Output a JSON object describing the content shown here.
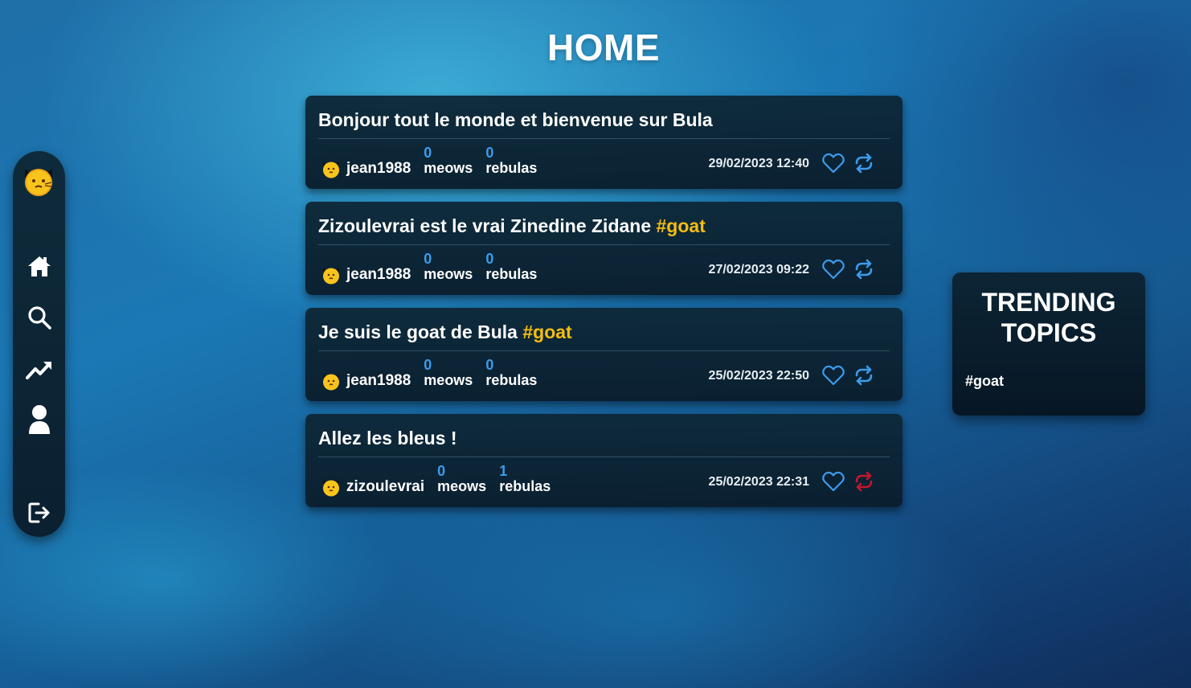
{
  "page": {
    "title": "HOME"
  },
  "sidebar": {
    "logo": "cat-logo-icon",
    "items": [
      {
        "icon": "home-icon",
        "label": "home"
      },
      {
        "icon": "search-icon",
        "label": "search"
      },
      {
        "icon": "trending-icon",
        "label": "trending"
      },
      {
        "icon": "user-icon",
        "label": "profile"
      },
      {
        "icon": "logout-icon",
        "label": "logout"
      }
    ]
  },
  "posts": [
    {
      "text": "Bonjour tout le monde et bienvenue sur Bula",
      "hashtag": "",
      "username": "jean1988",
      "meows": "0",
      "meows_label": "meows",
      "rebulas": "0",
      "rebulas_label": "rebulas",
      "date": "29/02/2023 12:40",
      "rebula_color": "#3d9bea"
    },
    {
      "text": "Zizoulevrai est le vrai Zinedine Zidane ",
      "hashtag": "#goat",
      "username": "jean1988",
      "meows": "0",
      "meows_label": "meows",
      "rebulas": "0",
      "rebulas_label": "rebulas",
      "date": "27/02/2023 09:22",
      "rebula_color": "#3d9bea"
    },
    {
      "text": "Je suis le goat de Bula ",
      "hashtag": "#goat",
      "username": "jean1988",
      "meows": "0",
      "meows_label": "meows",
      "rebulas": "0",
      "rebulas_label": "rebulas",
      "date": "25/02/2023 22:50",
      "rebula_color": "#3d9bea"
    },
    {
      "text": "Allez les bleus !",
      "hashtag": "",
      "username": "zizoulevrai",
      "meows": "0",
      "meows_label": "meows",
      "rebulas": "1",
      "rebulas_label": "rebulas",
      "date": "25/02/2023 22:31",
      "rebula_color": "#c4162f"
    }
  ],
  "trending": {
    "title_line1": "TRENDING",
    "title_line2": "TOPICS",
    "tags": [
      "#goat"
    ]
  },
  "colors": {
    "accent": "#3d9bea",
    "hashtag": "#f5bd10",
    "rebulaActive": "#c4162f",
    "catFace": "#f5bd10"
  }
}
